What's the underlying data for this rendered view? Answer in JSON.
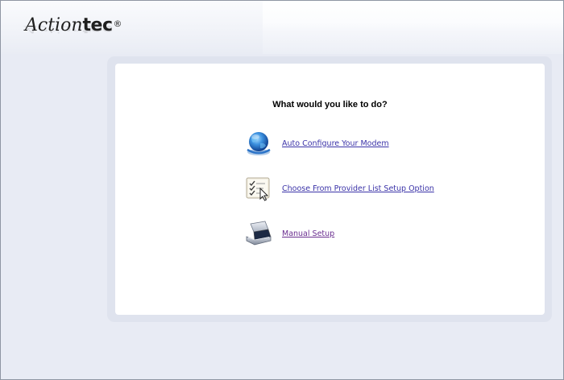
{
  "header": {
    "logo_italic": "Action",
    "logo_bold": "tec",
    "logo_reg": "®"
  },
  "main": {
    "question": "What would you like to do?",
    "options": [
      {
        "label": "Auto Configure Your Modem",
        "icon": "globe-icon"
      },
      {
        "label": "Choose From Provider List Setup Option",
        "icon": "checklist-icon"
      },
      {
        "label": "Manual Setup",
        "icon": "scanner-icon"
      }
    ]
  },
  "colors": {
    "link": "#3b33a8",
    "link_visited": "#6a2e8f",
    "background": "#e8ebf4",
    "panel_border": "#dfe3ee"
  }
}
